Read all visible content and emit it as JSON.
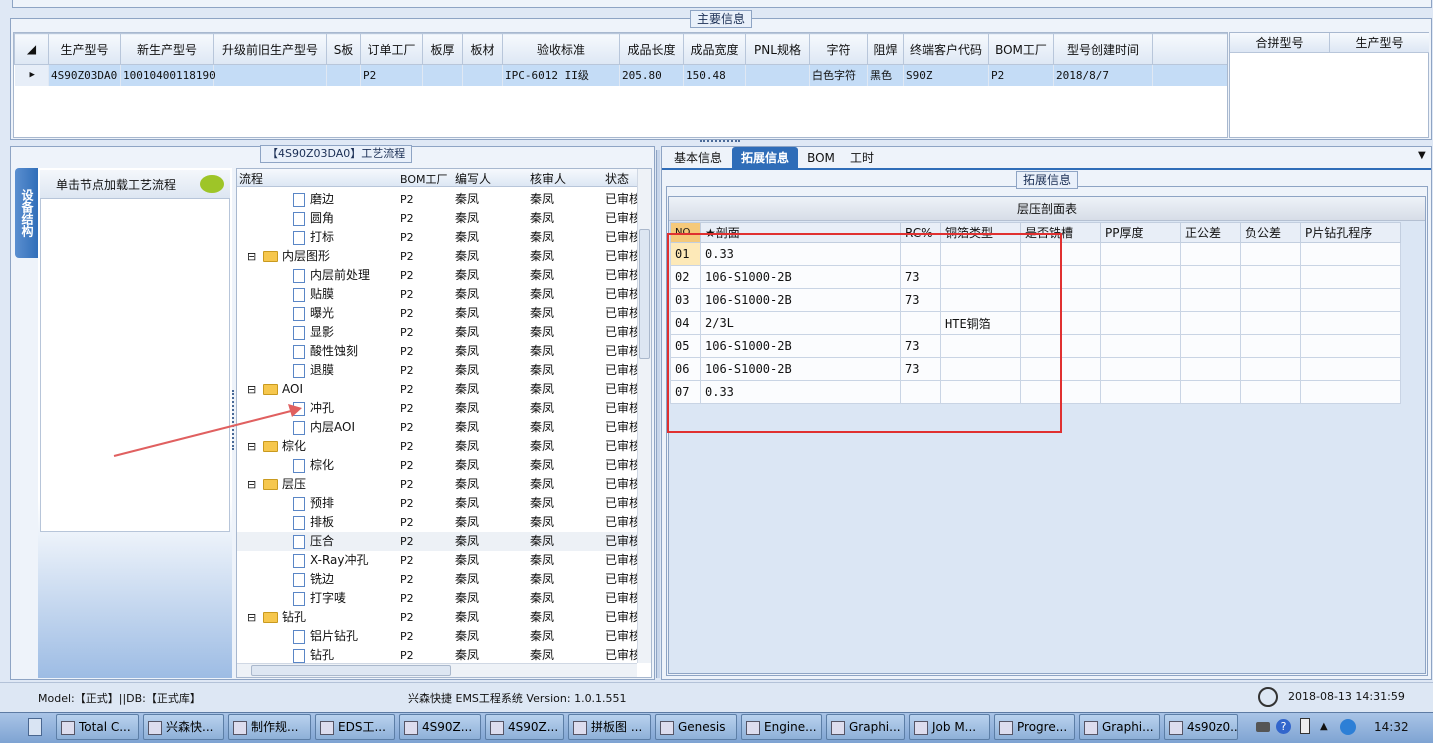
{
  "main_info": {
    "title": "主要信息",
    "columns": [
      "生产型号",
      "新生产型号",
      "升级前旧生产型号",
      "S板",
      "订单工厂",
      "板厚",
      "板材",
      "验收标准",
      "成品长度",
      "成品宽度",
      "PNL规格",
      "字符",
      "阻焊",
      "终端客户代码",
      "BOM工厂",
      "型号创建时间"
    ],
    "row": [
      "4S90Z03DA0",
      "10010400118190",
      "",
      "",
      "P2",
      "",
      "",
      "IPC-6012 II级",
      "205.80",
      "150.48",
      "",
      "白色字符",
      "黑色",
      "S90Z",
      "P2",
      "2018/8/7"
    ],
    "side_columns": [
      "合拼型号",
      "生产型号"
    ]
  },
  "process": {
    "title": "【4S90Z03DA0】工艺流程",
    "side_tab": "设备结构",
    "hint": "单击节点加载工艺流程",
    "columns": [
      "流程",
      "BOM工厂",
      "编写人",
      "核审人",
      "状态"
    ],
    "rows": [
      {
        "t": "doc",
        "l": 2,
        "name": "磨边",
        "bom": "P2",
        "w": "秦凤",
        "r": "秦凤",
        "s": "已审核"
      },
      {
        "t": "doc",
        "l": 2,
        "name": "圆角",
        "bom": "P2",
        "w": "秦凤",
        "r": "秦凤",
        "s": "已审核"
      },
      {
        "t": "doc",
        "l": 2,
        "name": "打标",
        "bom": "P2",
        "w": "秦凤",
        "r": "秦凤",
        "s": "已审核"
      },
      {
        "t": "fold",
        "l": 1,
        "name": "内层图形",
        "bom": "P2",
        "w": "秦凤",
        "r": "秦凤",
        "s": "已审核"
      },
      {
        "t": "doc",
        "l": 2,
        "name": "内层前处理",
        "bom": "P2",
        "w": "秦凤",
        "r": "秦凤",
        "s": "已审核"
      },
      {
        "t": "doc",
        "l": 2,
        "name": "贴膜",
        "bom": "P2",
        "w": "秦凤",
        "r": "秦凤",
        "s": "已审核"
      },
      {
        "t": "doc",
        "l": 2,
        "name": "曝光",
        "bom": "P2",
        "w": "秦凤",
        "r": "秦凤",
        "s": "已审核"
      },
      {
        "t": "doc",
        "l": 2,
        "name": "显影",
        "bom": "P2",
        "w": "秦凤",
        "r": "秦凤",
        "s": "已审核"
      },
      {
        "t": "doc",
        "l": 2,
        "name": "酸性蚀刻",
        "bom": "P2",
        "w": "秦凤",
        "r": "秦凤",
        "s": "已审核"
      },
      {
        "t": "doc",
        "l": 2,
        "name": "退膜",
        "bom": "P2",
        "w": "秦凤",
        "r": "秦凤",
        "s": "已审核"
      },
      {
        "t": "fold",
        "l": 1,
        "name": "AOI",
        "bom": "P2",
        "w": "秦凤",
        "r": "秦凤",
        "s": "已审核"
      },
      {
        "t": "doc",
        "l": 2,
        "name": "冲孔",
        "bom": "P2",
        "w": "秦凤",
        "r": "秦凤",
        "s": "已审核"
      },
      {
        "t": "doc",
        "l": 2,
        "name": "内层AOI",
        "bom": "P2",
        "w": "秦凤",
        "r": "秦凤",
        "s": "已审核"
      },
      {
        "t": "fold",
        "l": 1,
        "name": "棕化",
        "bom": "P2",
        "w": "秦凤",
        "r": "秦凤",
        "s": "已审核"
      },
      {
        "t": "doc",
        "l": 2,
        "name": "棕化",
        "bom": "P2",
        "w": "秦凤",
        "r": "秦凤",
        "s": "已审核"
      },
      {
        "t": "fold",
        "l": 1,
        "name": "层压",
        "bom": "P2",
        "w": "秦凤",
        "r": "秦凤",
        "s": "已审核"
      },
      {
        "t": "doc",
        "l": 2,
        "name": "预排",
        "bom": "P2",
        "w": "秦凤",
        "r": "秦凤",
        "s": "已审核"
      },
      {
        "t": "doc",
        "l": 2,
        "name": "排板",
        "bom": "P2",
        "w": "秦凤",
        "r": "秦凤",
        "s": "已审核"
      },
      {
        "t": "doc",
        "l": 2,
        "name": "压合",
        "bom": "P2",
        "w": "秦凤",
        "r": "秦凤",
        "s": "已审核",
        "sel": true
      },
      {
        "t": "doc",
        "l": 2,
        "name": "X-Ray冲孔",
        "bom": "P2",
        "w": "秦凤",
        "r": "秦凤",
        "s": "已审核"
      },
      {
        "t": "doc",
        "l": 2,
        "name": "铣边",
        "bom": "P2",
        "w": "秦凤",
        "r": "秦凤",
        "s": "已审核"
      },
      {
        "t": "doc",
        "l": 2,
        "name": "打字唛",
        "bom": "P2",
        "w": "秦凤",
        "r": "秦凤",
        "s": "已审核"
      },
      {
        "t": "fold",
        "l": 1,
        "name": "钻孔",
        "bom": "P2",
        "w": "秦凤",
        "r": "秦凤",
        "s": "已审核"
      },
      {
        "t": "doc",
        "l": 2,
        "name": "铝片钻孔",
        "bom": "P2",
        "w": "秦凤",
        "r": "秦凤",
        "s": "已审核"
      },
      {
        "t": "doc",
        "l": 2,
        "name": "钻孔",
        "bom": "P2",
        "w": "秦凤",
        "r": "秦凤",
        "s": "已审核"
      }
    ]
  },
  "tabs": [
    "基本信息",
    "拓展信息",
    "BOM",
    "工时"
  ],
  "active_tab": 1,
  "ext": {
    "group": "拓展信息",
    "table_title": "层压剖面表",
    "columns": [
      "NO",
      "★剖面",
      "RC%",
      "铜箔类型",
      "是否铣槽",
      "PP厚度",
      "正公差",
      "负公差",
      "P片钻孔程序"
    ],
    "rows": [
      [
        "01",
        "0.33",
        "",
        "",
        "",
        "",
        "",
        "",
        ""
      ],
      [
        "02",
        "106-S1000-2B",
        "73",
        "",
        "",
        "",
        "",
        "",
        ""
      ],
      [
        "03",
        "106-S1000-2B",
        "73",
        "",
        "",
        "",
        "",
        "",
        ""
      ],
      [
        "04",
        "2/3L",
        "",
        "HTE铜箔",
        "",
        "",
        "",
        "",
        ""
      ],
      [
        "05",
        "106-S1000-2B",
        "73",
        "",
        "",
        "",
        "",
        "",
        ""
      ],
      [
        "06",
        "106-S1000-2B",
        "73",
        "",
        "",
        "",
        "",
        "",
        ""
      ],
      [
        "07",
        "0.33",
        "",
        "",
        "",
        "",
        "",
        "",
        ""
      ]
    ]
  },
  "status": {
    "left": "Model:【正式】||DB:【正式库】",
    "center": "兴森快捷 EMS工程系统 Version: 1.0.1.551",
    "time": "2018-08-13 14:31:59"
  },
  "taskbar": {
    "items": [
      "Total C...",
      "兴森快...",
      "制作规...",
      "EDS工...",
      "4S90Z...",
      "4S90Z...",
      "拼板图 ...",
      "Genesis",
      "Engine...",
      "Graphi...",
      "Job M...",
      "Progre...",
      "Graphi...",
      "4s90z0..."
    ],
    "clock": "14:32"
  },
  "colors": {
    "accent": "#2f6db8",
    "annotation": "#e03030"
  }
}
